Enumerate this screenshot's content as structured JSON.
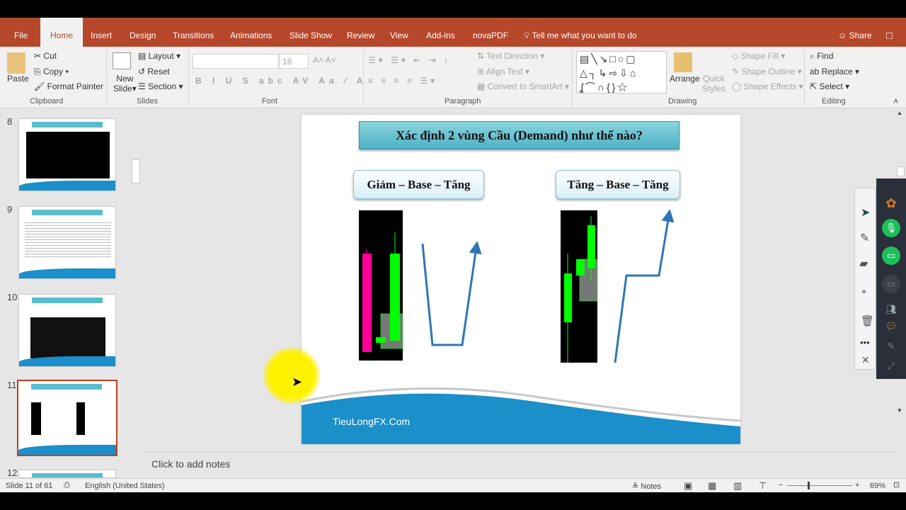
{
  "tabs": [
    "File",
    "Home",
    "Insert",
    "Design",
    "Transitions",
    "Animations",
    "Slide Show",
    "Review",
    "View",
    "Add-ins",
    "novaPDF"
  ],
  "active_tab": "Home",
  "tell_me": "Tell me what you want to do",
  "share": "Share",
  "ribbon": {
    "clipboard": {
      "paste": "Paste",
      "cut": "Cut",
      "copy": "Copy",
      "format_painter": "Format Painter",
      "label": "Clipboard"
    },
    "slides": {
      "new_slide_1": "New",
      "new_slide_2": "Slide",
      "layout": "Layout",
      "reset": "Reset",
      "section": "Section",
      "label": "Slides"
    },
    "font": {
      "size": "18",
      "label": "Font"
    },
    "paragraph": {
      "text_direction": "Text Direction",
      "align_text": "Align Text",
      "convert_smartart": "Convert to SmartArt",
      "label": "Paragraph"
    },
    "drawing": {
      "arrange": "Arrange",
      "quick_styles_1": "Quick",
      "quick_styles_2": "Styles",
      "shape_fill": "Shape Fill",
      "shape_outline": "Shape Outline",
      "shape_effects": "Shape Effects",
      "label": "Drawing"
    },
    "editing": {
      "find": "Find",
      "replace": "Replace",
      "select": "Select",
      "label": "Editing"
    }
  },
  "thumbnails": [
    {
      "num": "8"
    },
    {
      "num": "9"
    },
    {
      "num": "10"
    },
    {
      "num": "11",
      "selected": true
    },
    {
      "num": "12"
    }
  ],
  "slide": {
    "title": "Xác định 2 vùng Cầu (Demand) như thế nào?",
    "left_label": "Giảm – Base – Tăng",
    "right_label": "Tăng – Base – Tăng",
    "footer": "TieuLongFX.Com"
  },
  "notes_placeholder": "Click to add notes",
  "status": {
    "slide": "Slide 11 of 61",
    "language": "English (United States)",
    "notes": "Notes",
    "zoom": "69%",
    "zoom_level": 69
  },
  "colors": {
    "accent": "#b7472a",
    "title_box": "#5bbccc",
    "footer_blue": "#1a8fc9",
    "line_blue": "#2e75b6",
    "bull": "#00ff00",
    "bear": "#ff0099"
  }
}
